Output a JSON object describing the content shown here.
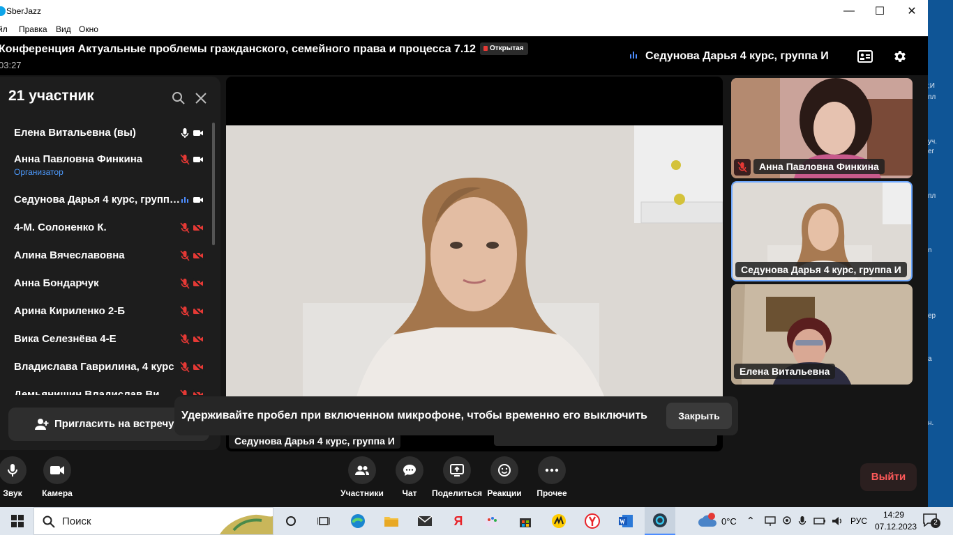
{
  "window": {
    "title": "SberJazz",
    "minimize": "—",
    "maximize": "☐",
    "close": "✕"
  },
  "menu": [
    "йл",
    "Правка",
    "Вид",
    "Окно"
  ],
  "conference": {
    "title": "Конференция Актуальные проблемы гражданского, семейного права и процесса 7.12",
    "badge": "Открытая",
    "timer": "03:27",
    "active_speaker": "Седунова Дарья 4 курс, группа И"
  },
  "participants_panel": {
    "header": "21 участник",
    "items": [
      {
        "name": "Елена Витальевна (вы)",
        "role": "",
        "mic": "on",
        "cam": "on"
      },
      {
        "name": "Анна Павловна Финкина",
        "role": "Организатор",
        "mic": "off",
        "cam": "on"
      },
      {
        "name": "Седунова Дарья 4 курс, группа И",
        "role": "",
        "mic": "speaking",
        "cam": "on"
      },
      {
        "name": "4-М. Солоненко К.",
        "role": "",
        "mic": "off",
        "cam": "off"
      },
      {
        "name": "Алина Вячеславовна",
        "role": "",
        "mic": "off",
        "cam": "off"
      },
      {
        "name": "Анна Бондарчук",
        "role": "",
        "mic": "off",
        "cam": "off"
      },
      {
        "name": "Арина Кириленко 2-Б",
        "role": "",
        "mic": "off",
        "cam": "off"
      },
      {
        "name": "Вика Селезнёва 4-Е",
        "role": "",
        "mic": "off",
        "cam": "off"
      },
      {
        "name": "Владислава Гаврилина, 4 курс",
        "role": "",
        "mic": "off",
        "cam": "off"
      },
      {
        "name": "Демьянишин Владислав Ви",
        "role": "",
        "mic": "off",
        "cam": "off"
      }
    ],
    "invite_label": "Пригласить на встречу"
  },
  "main_video": {
    "name_tag": "Седунова Дарья 4 курс, группа И"
  },
  "side_tiles": [
    {
      "name": "Анна Павловна Финкина",
      "muted": true
    },
    {
      "name": "Седунова Дарья 4 курс, группа И",
      "muted": false
    },
    {
      "name": "Елена Витальевна",
      "muted": false
    }
  ],
  "toast": {
    "text": "Удерживайте пробел при включенном микрофоне, чтобы временно его выключить",
    "close_label": "Закрыть"
  },
  "controls": {
    "sound": "Звук",
    "camera": "Камера",
    "participants": "Участники",
    "chat": "Чат",
    "share": "Поделиться",
    "reactions": "Реакции",
    "more": "Прочее",
    "leave": "Выйти"
  },
  "desktop_right_fragments": [
    ";И",
    "пл",
    "уч.",
    "ег",
    "пл",
    "n",
    "ер",
    "a",
    "н."
  ],
  "taskbar": {
    "search_placeholder": "Поиск",
    "weather": "0°C",
    "language": "РУС",
    "time": "14:29",
    "date": "07.12.2023",
    "notifications": "2"
  },
  "colors": {
    "accent": "#4d8dff",
    "danger": "#e53935",
    "leave": "#ff5a5a"
  }
}
